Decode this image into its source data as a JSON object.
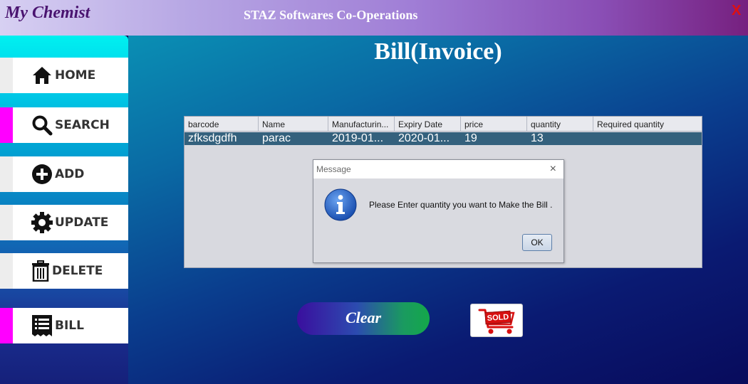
{
  "app": {
    "title": "My Chemist",
    "company": "STAZ Softwares Co-Operations",
    "close_label": "X"
  },
  "sidebar": {
    "items": [
      {
        "label": "HOME",
        "icon": "home-icon"
      },
      {
        "label": "SEARCH",
        "icon": "search-icon"
      },
      {
        "label": "ADD",
        "icon": "add-circle-icon"
      },
      {
        "label": "UPDATE",
        "icon": "gear-icon"
      },
      {
        "label": "DELETE",
        "icon": "trash-icon"
      },
      {
        "label": "BILL",
        "icon": "receipt-icon"
      }
    ]
  },
  "main": {
    "title": "Bill(Invoice)",
    "table": {
      "columns": [
        "barcode",
        "Name",
        "Manufacturin...",
        "Expiry Date",
        "price",
        "quantity",
        "Required quantity"
      ],
      "rows": [
        [
          "zfksdgdfh",
          "parac",
          "2019-01...",
          "2020-01...",
          "19",
          "13",
          ""
        ]
      ]
    },
    "clear_label": "Clear",
    "sold_label": "SOLD"
  },
  "dialog": {
    "title": "Message",
    "close_symbol": "×",
    "message": "Please Enter quantity you want to Make the Bill .",
    "ok_label": "OK",
    "icon": "info-icon"
  },
  "colors": {
    "title_text": "#4a1470",
    "close_red": "#e01010",
    "sidebar_accent": "#ff00ff",
    "row_selected": "#34617d",
    "sold_red": "#d81010"
  }
}
